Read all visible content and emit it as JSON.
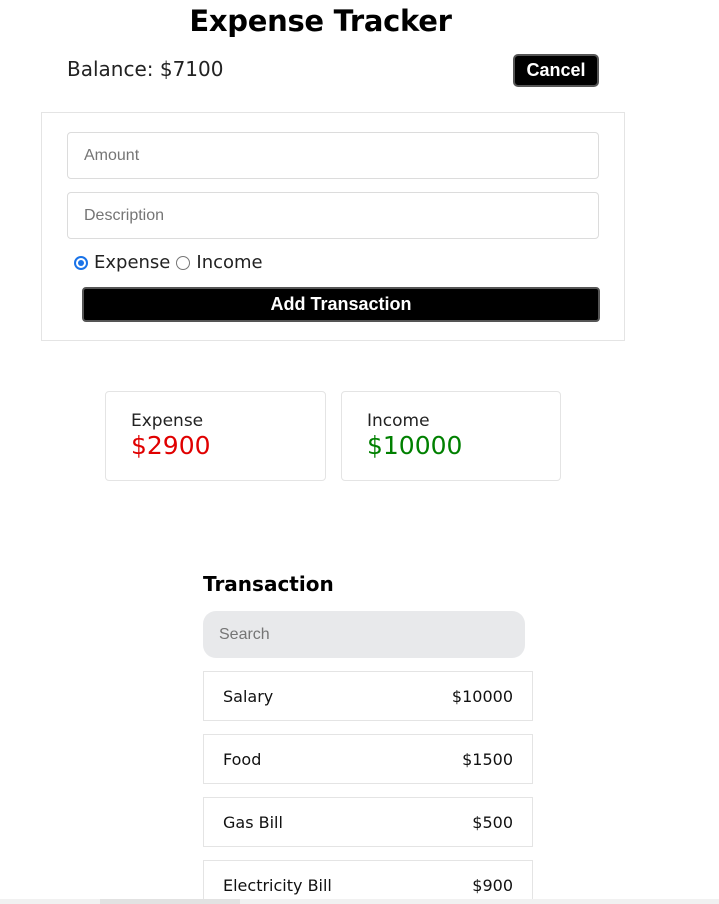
{
  "header": {
    "title": "Expense Tracker",
    "balance_text": "Balance: $7100",
    "cancel_label": "Cancel"
  },
  "form": {
    "amount_placeholder": "Amount",
    "description_placeholder": "Description",
    "type_options": [
      {
        "label": "Expense",
        "checked": true
      },
      {
        "label": "Income",
        "checked": false
      }
    ],
    "submit_label": "Add Transaction"
  },
  "summary": {
    "expense": {
      "label": "Expense",
      "value": "$2900",
      "color": "#e00000"
    },
    "income": {
      "label": "Income",
      "value": "$10000",
      "color": "#008000"
    }
  },
  "transactions": {
    "heading": "Transaction",
    "search_placeholder": "Search",
    "items": [
      {
        "name": "Salary",
        "amount": "$10000"
      },
      {
        "name": "Food",
        "amount": "$1500"
      },
      {
        "name": "Gas Bill",
        "amount": "$500"
      },
      {
        "name": "Electricity Bill",
        "amount": "$900"
      }
    ]
  }
}
